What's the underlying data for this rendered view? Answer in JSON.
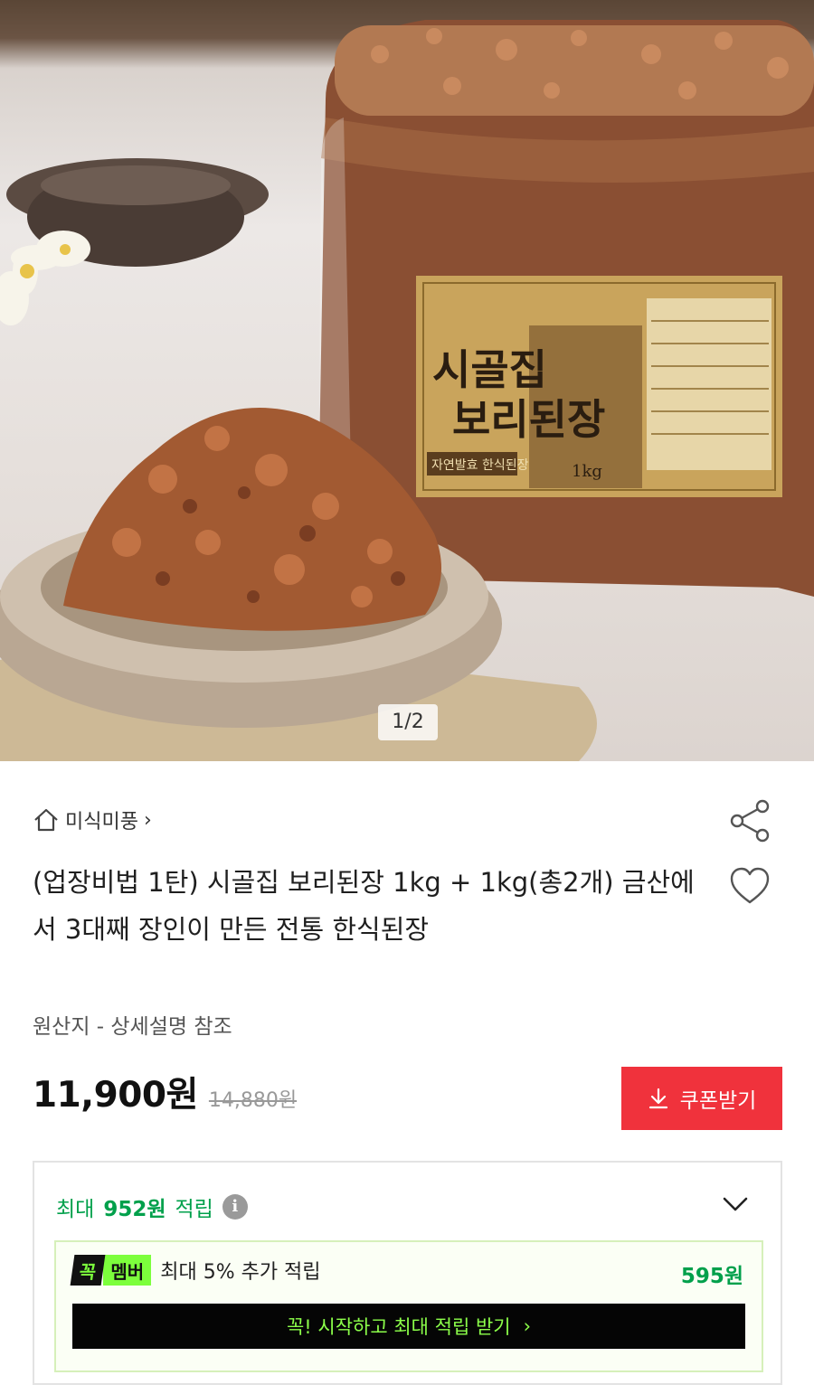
{
  "gallery": {
    "counter": "1/2",
    "label": {
      "line1": "시골집",
      "line2": "보리된장",
      "subtitle": "자연발효 한식된장",
      "weight": "1kg"
    }
  },
  "store": {
    "name": "미식미풍",
    "arrow": "›"
  },
  "product": {
    "title": "(업장비법 1탄) 시골집 보리된장 1kg + 1kg(총2개) 금산에서 3대째 장인이 만든 전통 한식된장",
    "origin": "원산지 - 상세설명 참조",
    "price": "11,900원",
    "original_price": "14,880원"
  },
  "coupon": {
    "label": "쿠폰받기"
  },
  "reward": {
    "prefix": "최대",
    "amount": "952원",
    "suffix": "적립",
    "info": "i"
  },
  "membership": {
    "badge_1": "꼭",
    "badge_2": "멤버",
    "text": "최대 5% 추가 적립",
    "points": "595원",
    "cta": "꼭! 시작하고 최대 적립 받기",
    "cta_arrow": "›"
  },
  "colors": {
    "accent_red": "#f0323c",
    "points_green": "#00a04b",
    "member_lime": "#7cff3c"
  }
}
